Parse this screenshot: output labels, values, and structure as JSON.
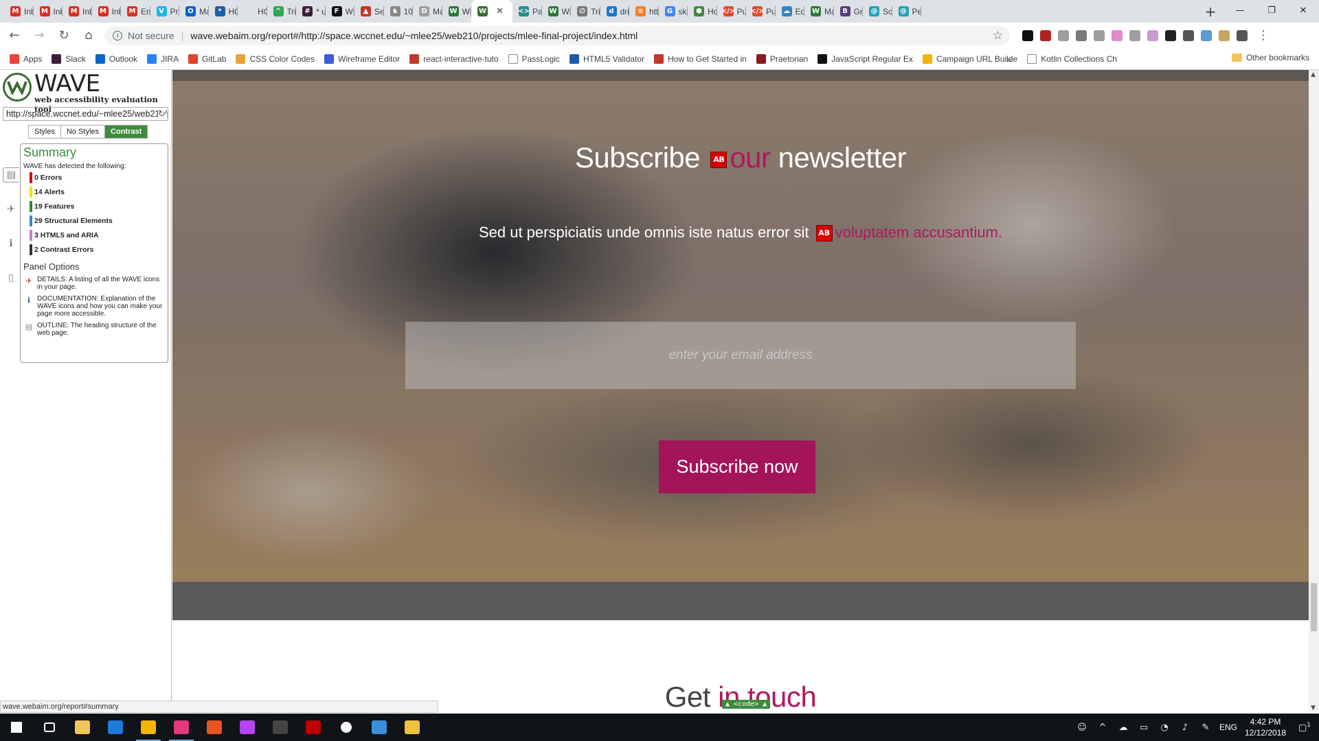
{
  "browser": {
    "tabs": [
      {
        "label": "Inb",
        "icon": "gmail-icon",
        "color": "#d93025",
        "glyph": "M"
      },
      {
        "label": "Inb",
        "icon": "gmail-icon",
        "color": "#d93025",
        "glyph": "M"
      },
      {
        "label": "Inb",
        "icon": "gmail-icon",
        "color": "#d93025",
        "glyph": "M"
      },
      {
        "label": "Inb",
        "icon": "gmail-icon",
        "color": "#d93025",
        "glyph": "M"
      },
      {
        "label": "Em",
        "icon": "gmail-icon",
        "color": "#d93025",
        "glyph": "M"
      },
      {
        "label": "Pri",
        "icon": "vimeo-icon",
        "color": "#1ab7ea",
        "glyph": "V"
      },
      {
        "label": "Ma",
        "icon": "outlook-icon",
        "color": "#0a64c8",
        "glyph": "O"
      },
      {
        "label": "HC",
        "icon": "hc-icon",
        "color": "#1d5fa8",
        "glyph": "*"
      },
      {
        "label": "HC",
        "icon": "blank-icon",
        "color": "#dee1e6",
        "glyph": ""
      },
      {
        "label": "Tri",
        "icon": "trello-icon",
        "color": "#2fa84f",
        "glyph": "^"
      },
      {
        "label": "* u",
        "icon": "slack-icon",
        "color": "#3a1f3b",
        "glyph": "#"
      },
      {
        "label": "Wi",
        "icon": "f-icon",
        "color": "#111111",
        "glyph": "F"
      },
      {
        "label": "Se",
        "icon": "triangle-icon",
        "color": "#c0392b",
        "glyph": "▲"
      },
      {
        "label": "10",
        "icon": "wolf-icon",
        "color": "#888888",
        "glyph": "♞"
      },
      {
        "label": "Ma",
        "icon": "doc-icon",
        "color": "#9e9e9e",
        "glyph": "D"
      },
      {
        "label": "Wi",
        "icon": "wcag-icon",
        "color": "#2c7a3a",
        "glyph": "W"
      },
      {
        "label": "",
        "icon": "wave-icon",
        "color": "#3d6b35",
        "glyph": "W",
        "active": true
      },
      {
        "label": "Pa",
        "icon": "code-icon",
        "color": "#2a8c8c",
        "glyph": "<>"
      },
      {
        "label": "Wi",
        "icon": "wcag-icon",
        "color": "#2c7a3a",
        "glyph": "W"
      },
      {
        "label": "Tri",
        "icon": "stop-icon",
        "color": "#777777",
        "glyph": "∅"
      },
      {
        "label": "dri",
        "icon": "drive-icon",
        "color": "#1976d2",
        "glyph": "d"
      },
      {
        "label": "htt",
        "icon": "stack-icon",
        "color": "#f48024",
        "glyph": "≡"
      },
      {
        "label": "ski",
        "icon": "google-icon",
        "color": "#4285f4",
        "glyph": "G"
      },
      {
        "label": "Hc",
        "icon": "node-icon",
        "color": "#43853d",
        "glyph": "⬢"
      },
      {
        "label": "Pu",
        "icon": "pub-icon",
        "color": "#e04a2f",
        "glyph": "</>"
      },
      {
        "label": "Pu",
        "icon": "pub-icon",
        "color": "#e04a2f",
        "glyph": "</>"
      },
      {
        "label": "Ed",
        "icon": "cloud-icon",
        "color": "#3b82c4",
        "glyph": "☁"
      },
      {
        "label": "Ma",
        "icon": "wcag-icon",
        "color": "#2c7a3a",
        "glyph": "W"
      },
      {
        "label": "Gr",
        "icon": "bootstrap-icon",
        "color": "#563d7c",
        "glyph": "B"
      },
      {
        "label": "Sc",
        "icon": "spiral-icon",
        "color": "#1ea3b5",
        "glyph": "@"
      },
      {
        "label": "Pe",
        "icon": "spiral-icon",
        "color": "#1ea3b5",
        "glyph": "@"
      }
    ],
    "new_tab": "+",
    "window": {
      "minimize": "—",
      "maximize": "❐",
      "close": "✕"
    },
    "nav": {
      "back": "←",
      "forward": "→",
      "reload": "↻",
      "home": "⌂"
    },
    "omnibox": {
      "security": "Not secure",
      "info_icon": "i",
      "url": "wave.webaim.org/report#/http://space.wccnet.edu/~mlee25/web210/projects/mlee-final-project/index.html",
      "star": "☆"
    },
    "extensions": [
      "#111111",
      "#b22222",
      "#9e9e9e",
      "#7a7a7a",
      "#9e9e9e",
      "#e08ad0",
      "#9e9e9e",
      "#c89ad0",
      "#222222",
      "#555555",
      "#5a9bd6",
      "#c8a35a",
      "#555555"
    ]
  },
  "bookmarks": {
    "items": [
      {
        "label": "Apps",
        "icon": "apps-grid-icon",
        "color": "#e8453c"
      },
      {
        "label": "Slack",
        "icon": "slack-icon",
        "color": "#3a1f3b"
      },
      {
        "label": "Outlook",
        "icon": "outlook-icon",
        "color": "#0a64c8"
      },
      {
        "label": "JIRA",
        "icon": "jira-icon",
        "color": "#2684ff"
      },
      {
        "label": "GitLab",
        "icon": "gitlab-icon",
        "color": "#e24329"
      },
      {
        "label": "CSS Color Codes",
        "icon": "search-icon",
        "color": "#e8a33c"
      },
      {
        "label": "Wireframe Editor",
        "icon": "wireframe-icon",
        "color": "#3b5bdb"
      },
      {
        "label": "react-interactive-tuto",
        "icon": "react-icon",
        "color": "#c0392b"
      },
      {
        "label": "PassLogic",
        "icon": "doc-icon",
        "color": "#ffffff"
      },
      {
        "label": "HTML5 Validator",
        "icon": "w3c-icon",
        "color": "#1f5aa8"
      },
      {
        "label": "How to Get Started in",
        "icon": "book-icon",
        "color": "#c0392b"
      },
      {
        "label": "Praetorian",
        "icon": "praetorian-icon",
        "color": "#8b1a1a"
      },
      {
        "label": "JavaScript Regular Ex",
        "icon": "d-icon",
        "color": "#111111"
      },
      {
        "label": "Campaign URL Builde",
        "icon": "chrome-icon",
        "color": "#f4b400"
      },
      {
        "label": "Kotlin Collections Ch",
        "icon": "doc-icon",
        "color": "#ffffff"
      }
    ],
    "more": "»",
    "other": "Other bookmarks"
  },
  "wave": {
    "title": "WAVE",
    "subtitle": "web accessibility evaluation tool",
    "url_value": "http://space.wccnet.edu/~mlee25/web210/projects/mlee-final-project/index.html",
    "reload": "↻",
    "modes": [
      "Styles",
      "No Styles",
      "Contrast"
    ],
    "summary": {
      "title": "Summary",
      "intro": "WAVE has detected the following:",
      "rows": [
        {
          "label": "0 Errors",
          "color": "#d40000"
        },
        {
          "label": "14 Alerts",
          "color": "#f5e000"
        },
        {
          "label": "19 Features",
          "color": "#2d8a2d"
        },
        {
          "label": "29 Structural Elements",
          "color": "#3a86c8"
        },
        {
          "label": "3 HTML5 and ARIA",
          "color": "#c77bd0"
        },
        {
          "label": "2 Contrast Errors",
          "color": "#333333"
        }
      ]
    },
    "panel_options": {
      "title": "Panel Options",
      "items": [
        {
          "text": "DETAILS: A listing of all the WAVE icons in your page.",
          "icon": "flag-icon",
          "glyph": "✈"
        },
        {
          "text": "DOCUMENTATION: Explanation of the WAVE icons and how you can make your page more accessible.",
          "icon": "info-icon",
          "glyph": "ℹ"
        },
        {
          "text": "OUTLINE: The heading structure of the web page.",
          "icon": "outline-icon",
          "glyph": "▤"
        }
      ]
    }
  },
  "page": {
    "newsletter_title_before": "Subscribe",
    "newsletter_title_highlight": "our",
    "newsletter_title_after": " newsletter",
    "newsletter_text_before": "Sed ut perspiciatis unde omnis iste natus error sit ",
    "newsletter_text_highlight": "voluptatem accusantium",
    "newsletter_text_after": ".",
    "email_placeholder": "enter your email address",
    "subscribe_button": "Subscribe now",
    "touch_before": "Get ",
    "touch_highlight": "in touch",
    "contrast_icon": "AB",
    "code_badge": "▲ <code> ▲",
    "status_url": "wave.webaim.org/report#summary",
    "colors": {
      "accent": "#a3145a",
      "wave_green": "#3d8b3d"
    }
  },
  "taskbar": {
    "apps": [
      {
        "icon": "windows-start-icon",
        "color": "#ffffff"
      },
      {
        "icon": "task-view-icon",
        "color": "#ffffff"
      },
      {
        "icon": "file-explorer-icon",
        "color": "#f3c659"
      },
      {
        "icon": "edge-icon",
        "color": "#1f7ad8"
      },
      {
        "icon": "chrome-icon",
        "color": "#f4b400",
        "running": true
      },
      {
        "icon": "intellij-icon",
        "color": "#e3387f",
        "running": true
      },
      {
        "icon": "ubuntu-icon",
        "color": "#e95420"
      },
      {
        "icon": "phpstorm-icon",
        "color": "#b345f1"
      },
      {
        "icon": "terminal-icon",
        "color": "#444444"
      },
      {
        "icon": "filezilla-icon",
        "color": "#bf0000"
      },
      {
        "icon": "settings-icon",
        "color": "#ffffff"
      },
      {
        "icon": "remote-desktop-icon",
        "color": "#3b8fd8"
      },
      {
        "icon": "paint-icon",
        "color": "#f0c040"
      }
    ],
    "tray": {
      "lang": "ENG",
      "time": "4:42 PM",
      "date": "12/12/2018",
      "notifications": "1"
    }
  }
}
